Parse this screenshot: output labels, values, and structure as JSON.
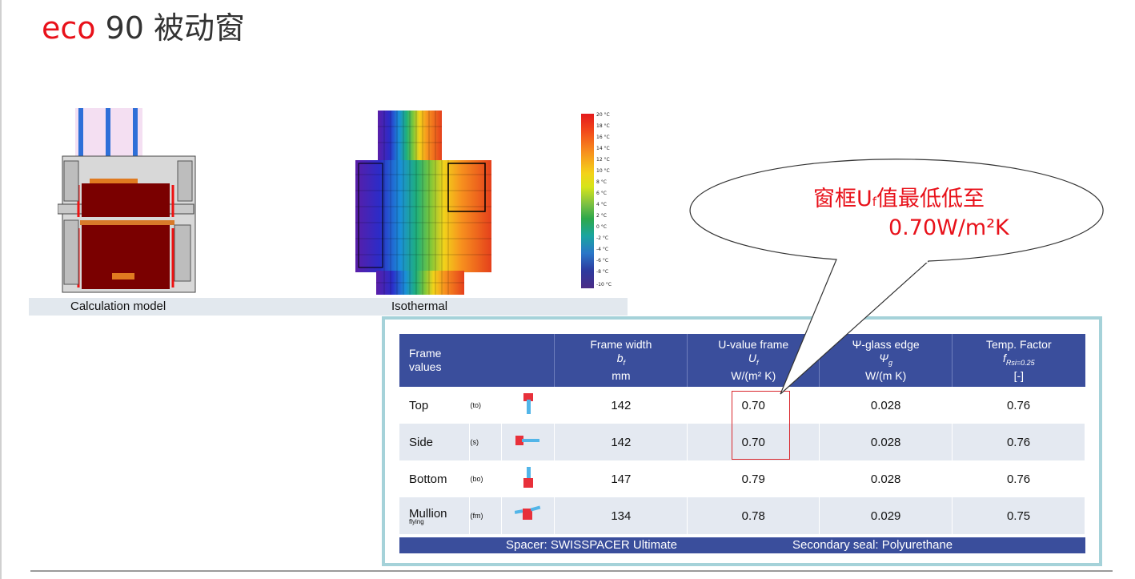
{
  "page": {
    "title_brand": "eco",
    "title_rest": " 90 被动窗"
  },
  "figures": {
    "calc_caption": "Calculation model",
    "iso_caption": "Isothermal",
    "scale_labels": [
      "20 °C",
      "18 °C",
      "16 °C",
      "14 °C",
      "12 °C",
      "10 °C",
      "8 °C",
      "6 °C",
      "4 °C",
      "2 °C",
      "0 °C",
      "-2 °C",
      "-4 °C",
      "-6 °C",
      "-8 °C",
      "-10 °C"
    ]
  },
  "callout": {
    "line1": "窗框U",
    "line1_sub": "f",
    "line1_rest": "值最低低至",
    "line2": "0.70W/m²K"
  },
  "table": {
    "headers": {
      "frame_values": [
        "Frame",
        "values"
      ],
      "frame_width": [
        "Frame width",
        "b",
        "f",
        "mm"
      ],
      "u_value": [
        "U-value frame",
        "U",
        "f",
        "W/(m² K)"
      ],
      "psi": [
        "Ψ-glass edge",
        "Ψ",
        "g",
        "W/(m K)"
      ],
      "temp": [
        "Temp. Factor",
        "f",
        "Rsi=0.25",
        "[-]"
      ]
    },
    "rows": [
      {
        "name": "Top",
        "sub": "",
        "abbr": "(to)",
        "width": "142",
        "u": "0.70",
        "psi": "0.028",
        "temp": "0.76"
      },
      {
        "name": "Side",
        "sub": "",
        "abbr": "(s)",
        "width": "142",
        "u": "0.70",
        "psi": "0.028",
        "temp": "0.76"
      },
      {
        "name": "Bottom",
        "sub": "",
        "abbr": "(bo)",
        "width": "147",
        "u": "0.79",
        "psi": "0.028",
        "temp": "0.76"
      },
      {
        "name": "Mullion",
        "sub": "flying",
        "abbr": "(fm)",
        "width": "134",
        "u": "0.78",
        "psi": "0.029",
        "temp": "0.75"
      }
    ],
    "footer": {
      "spacer": "Spacer: SWISSPACER Ultimate",
      "seal": "Secondary seal: Polyurethane"
    }
  },
  "colors": {
    "accent_red": "#e8111a",
    "header_blue": "#3a4e9c",
    "panel_border": "#a5d2d9"
  }
}
